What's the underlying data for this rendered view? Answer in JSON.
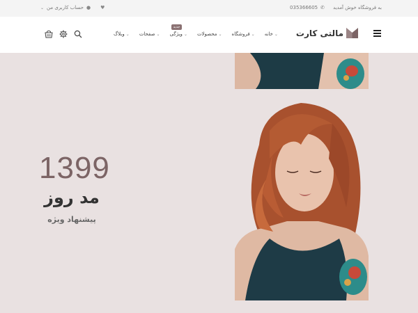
{
  "topbar": {
    "welcome": "به فروشگاه خوش آمدید",
    "phone": "035366605",
    "account": "حساب کاربری من"
  },
  "header": {
    "logo_text": "مالتی کارت",
    "nav": [
      {
        "label": "خانه"
      },
      {
        "label": "فروشگاه"
      },
      {
        "label": "محصولات"
      },
      {
        "label": "ویژگی",
        "badge": "جدید"
      },
      {
        "label": "صفحات"
      },
      {
        "label": "وبلاگ"
      }
    ]
  },
  "hero": {
    "number": "1399",
    "title": "مد روز",
    "subtitle": "پیشنهاد ویژه"
  },
  "colors": {
    "accent": "#8a7172",
    "hero_bg": "#e9e1e1",
    "number_color": "#7c6465"
  }
}
